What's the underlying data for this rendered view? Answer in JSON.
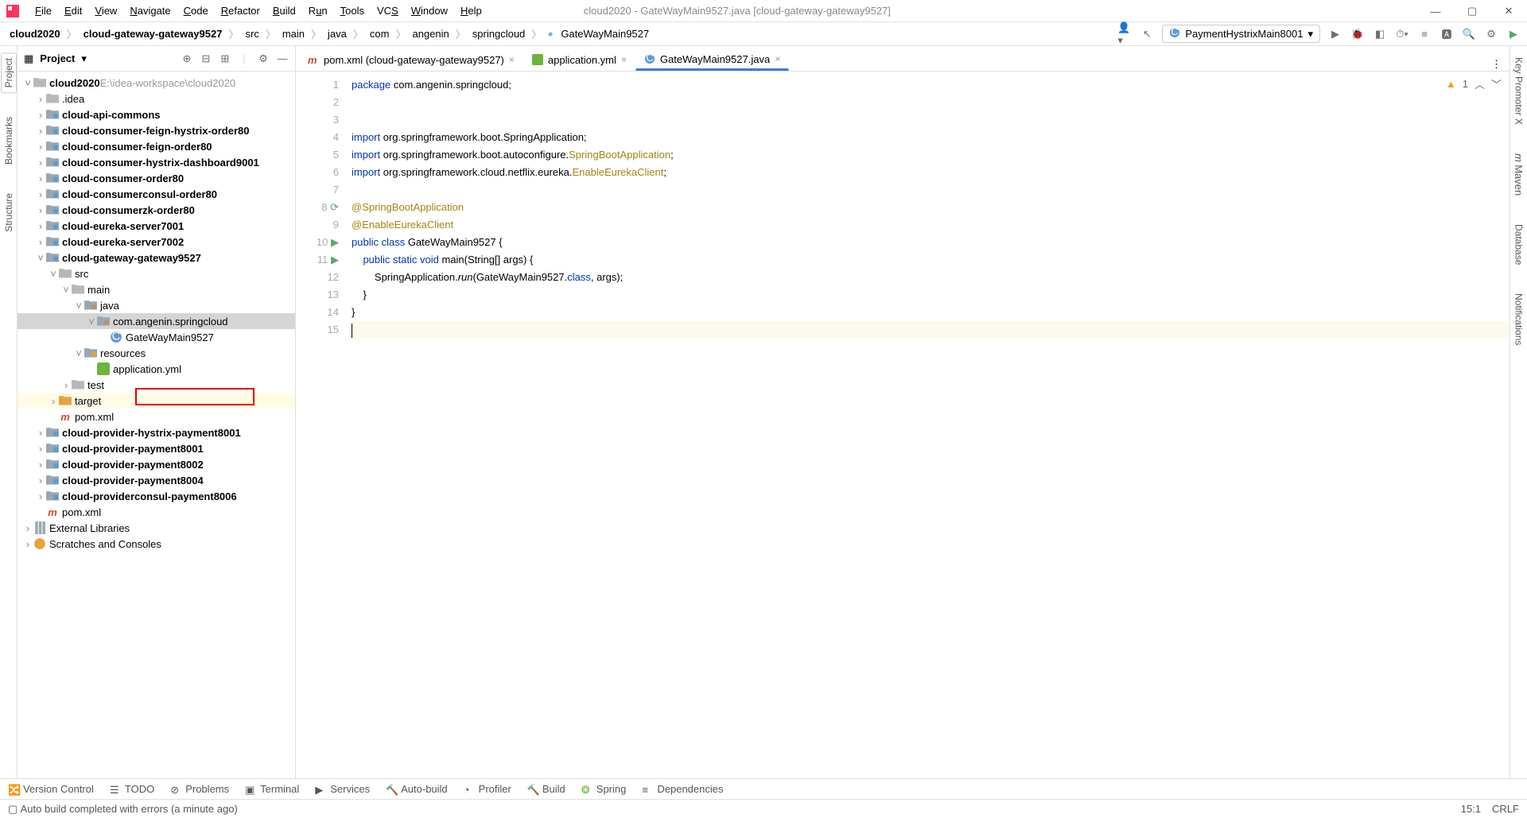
{
  "window": {
    "title": "cloud2020 - GateWayMain9527.java [cloud-gateway-gateway9527]"
  },
  "menu": {
    "file": "File",
    "edit": "Edit",
    "view": "View",
    "navigate": "Navigate",
    "code": "Code",
    "refactor": "Refactor",
    "build": "Build",
    "run": "Run",
    "tools": "Tools",
    "vcs": "VCS",
    "window": "Window",
    "help": "Help"
  },
  "breadcrumb": [
    "cloud2020",
    "cloud-gateway-gateway9527",
    "src",
    "main",
    "java",
    "com",
    "angenin",
    "springcloud",
    "GateWayMain9527"
  ],
  "run_config": "PaymentHystrixMain8001",
  "project_panel": {
    "title": "Project"
  },
  "tree": {
    "root": {
      "name": "cloud2020",
      "path": "E:\\idea-workspace\\cloud2020"
    },
    "modules": [
      ".idea",
      "cloud-api-commons",
      "cloud-consumer-feign-hystrix-order80",
      "cloud-consumer-feign-order80",
      "cloud-consumer-hystrix-dashboard9001",
      "cloud-consumer-order80",
      "cloud-consumerconsul-order80",
      "cloud-consumerzk-order80",
      "cloud-eureka-server7001",
      "cloud-eureka-server7002"
    ],
    "open_module": "cloud-gateway-gateway9527",
    "src": "src",
    "main": "main",
    "java": "java",
    "pkg": "com.angenin.springcloud",
    "cls": "GateWayMain9527",
    "resources": "resources",
    "appyml": "application.yml",
    "test": "test",
    "target": "target",
    "pom": "pom.xml",
    "after_modules": [
      "cloud-provider-hystrix-payment8001",
      "cloud-provider-payment8001",
      "cloud-provider-payment8002",
      "cloud-provider-payment8004",
      "cloud-providerconsul-payment8006"
    ],
    "rootpom": "pom.xml",
    "extlib": "External Libraries",
    "scratches": "Scratches and Consoles"
  },
  "tabs": [
    {
      "label": "pom.xml (cloud-gateway-gateway9527)",
      "type": "maven"
    },
    {
      "label": "application.yml",
      "type": "yml"
    },
    {
      "label": "GateWayMain9527.java",
      "type": "java",
      "active": true
    }
  ],
  "code": {
    "lines": [
      {
        "n": 1,
        "segs": [
          {
            "t": "package ",
            "c": "kw"
          },
          {
            "t": "com.angenin.springcloud;",
            "c": ""
          }
        ]
      },
      {
        "n": 2,
        "segs": []
      },
      {
        "n": 3,
        "segs": []
      },
      {
        "n": 4,
        "segs": [
          {
            "t": "import ",
            "c": "kw"
          },
          {
            "t": "org.springframework.boot.SpringApplication;",
            "c": ""
          }
        ]
      },
      {
        "n": 5,
        "segs": [
          {
            "t": "import ",
            "c": "kw"
          },
          {
            "t": "org.springframework.boot.autoconfigure.",
            "c": ""
          },
          {
            "t": "SpringBootApplication",
            "c": "ann"
          },
          {
            "t": ";",
            "c": ""
          }
        ]
      },
      {
        "n": 6,
        "segs": [
          {
            "t": "import ",
            "c": "kw"
          },
          {
            "t": "org.springframework.cloud.netflix.eureka.",
            "c": ""
          },
          {
            "t": "EnableEurekaClient",
            "c": "ann"
          },
          {
            "t": ";",
            "c": ""
          }
        ]
      },
      {
        "n": 7,
        "segs": []
      },
      {
        "n": 8,
        "segs": [
          {
            "t": "@SpringBootApplication",
            "c": "ann"
          }
        ],
        "gut": "reload"
      },
      {
        "n": 9,
        "segs": [
          {
            "t": "@EnableEurekaClient",
            "c": "ann"
          }
        ]
      },
      {
        "n": 10,
        "segs": [
          {
            "t": "public class ",
            "c": "kw"
          },
          {
            "t": "GateWayMain9527 {",
            "c": ""
          }
        ],
        "gut": "run"
      },
      {
        "n": 11,
        "segs": [
          {
            "t": "    public static void ",
            "c": "kw"
          },
          {
            "t": "main",
            "c": ""
          },
          {
            "t": "(String[] args) {",
            "c": ""
          }
        ],
        "gut": "run"
      },
      {
        "n": 12,
        "segs": [
          {
            "t": "        SpringApplication.",
            "c": ""
          },
          {
            "t": "run",
            "c": "it"
          },
          {
            "t": "(GateWayMain9527.",
            "c": ""
          },
          {
            "t": "class",
            "c": "kw"
          },
          {
            "t": ", args);",
            "c": ""
          }
        ]
      },
      {
        "n": 13,
        "segs": [
          {
            "t": "    }",
            "c": ""
          }
        ]
      },
      {
        "n": 14,
        "segs": [
          {
            "t": "}",
            "c": ""
          }
        ]
      },
      {
        "n": 15,
        "segs": [],
        "cursor": true
      }
    ]
  },
  "warnings": {
    "count": "1"
  },
  "bottom": {
    "vc": "Version Control",
    "todo": "TODO",
    "problems": "Problems",
    "terminal": "Terminal",
    "services": "Services",
    "autobuild": "Auto-build",
    "profiler": "Profiler",
    "build": "Build",
    "spring": "Spring",
    "deps": "Dependencies"
  },
  "status": {
    "msg": "Auto build completed with errors (a minute ago)",
    "pos": "15:1",
    "enc": "CRLF"
  },
  "leftrail": {
    "project": "Project",
    "bookmarks": "Bookmarks",
    "structure": "Structure"
  },
  "rightrail": {
    "keypromoter": "Key Promoter X",
    "maven": "Maven",
    "database": "Database",
    "notifications": "Notifications"
  }
}
